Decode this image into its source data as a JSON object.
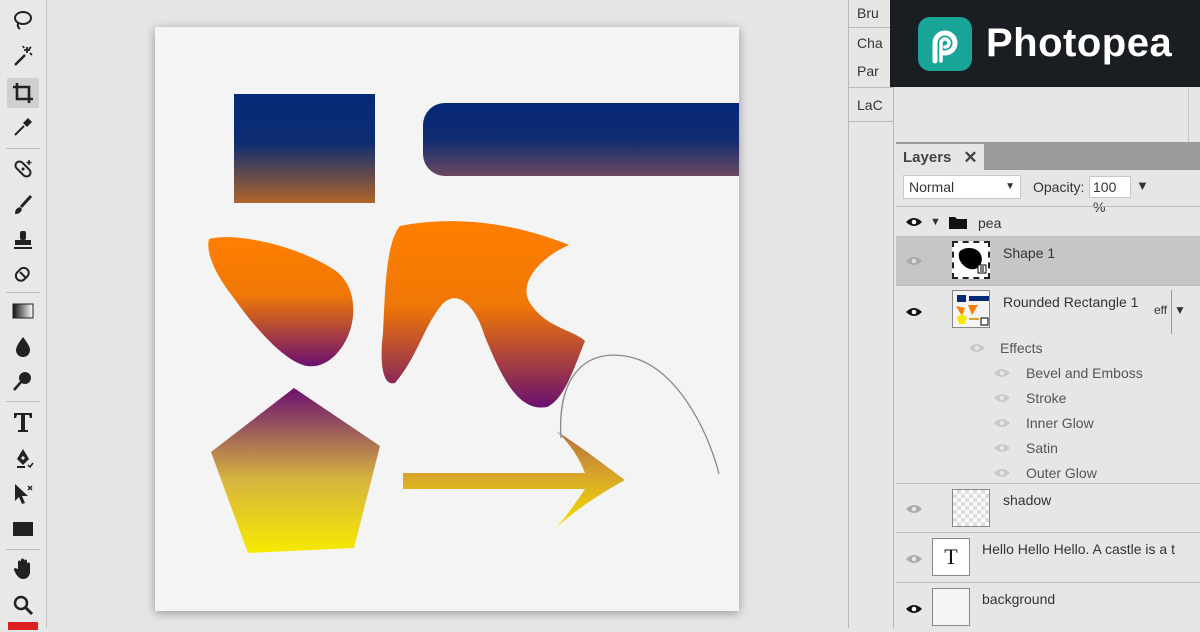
{
  "app": {
    "brand_name": "Photopea",
    "brand_bg": "#1a1d22",
    "brand_accent": "#18a497"
  },
  "toolbar": {
    "tools": [
      {
        "name": "lasso-tool",
        "icon": "lasso-icon"
      },
      {
        "name": "magic-wand-tool",
        "icon": "magic-wand-icon"
      },
      {
        "name": "crop-tool",
        "icon": "crop-icon",
        "active": true
      },
      {
        "name": "eyedropper-tool",
        "icon": "eyedropper-icon"
      },
      {
        "name": "healing-brush-tool",
        "icon": "bandage-icon"
      },
      {
        "name": "brush-tool",
        "icon": "brush-icon"
      },
      {
        "name": "clone-stamp-tool",
        "icon": "stamp-icon"
      },
      {
        "name": "eraser-tool",
        "icon": "eraser-icon"
      },
      {
        "name": "gradient-tool",
        "icon": "gradient-icon"
      },
      {
        "name": "blur-tool",
        "icon": "drop-icon"
      },
      {
        "name": "dodge-tool",
        "icon": "dodge-icon"
      },
      {
        "name": "type-tool",
        "icon": "type-icon"
      },
      {
        "name": "pen-tool",
        "icon": "pen-icon"
      },
      {
        "name": "path-select-tool",
        "icon": "direct-select-icon"
      },
      {
        "name": "rectangle-tool",
        "icon": "rectangle-icon"
      },
      {
        "name": "hand-tool",
        "icon": "hand-icon"
      },
      {
        "name": "zoom-tool",
        "icon": "zoom-icon"
      }
    ],
    "foreground_color": "#e02020"
  },
  "side_panels": [
    "Bru",
    "Cha",
    "Par",
    "LaC"
  ],
  "layers_panel": {
    "title": "Layers",
    "close_glyph": "✕",
    "blend_mode": "Normal",
    "opacity_label": "Opacity:",
    "opacity_value": "100 %",
    "dropdown_glyph": "▼",
    "layers": [
      {
        "name": "pea",
        "type": "group",
        "visible": true
      },
      {
        "name": "Shape 1",
        "type": "shape",
        "visible": false,
        "selected": true
      },
      {
        "name": "Rounded Rectangle 1",
        "type": "shape",
        "visible": true,
        "fx_label": "eff",
        "effects_label": "Effects",
        "effects": [
          "Bevel and Emboss",
          "Stroke",
          "Inner Glow",
          "Satin",
          "Outer Glow"
        ]
      },
      {
        "name": "shadow",
        "type": "raster",
        "visible": false
      },
      {
        "name": "Hello Hello Hello. A castle is a t",
        "type": "text",
        "visible": false,
        "thumb_glyph": "T"
      },
      {
        "name": "background",
        "type": "raster",
        "visible": true
      }
    ]
  },
  "canvas": {
    "background": "#f4f4f4",
    "colors": {
      "navy": "#062a78",
      "rust": "#b0652b",
      "orange": "#ff7e00",
      "purple": "#6a1070",
      "yellow": "#f7ea00",
      "gold": "#d8a42a"
    }
  }
}
